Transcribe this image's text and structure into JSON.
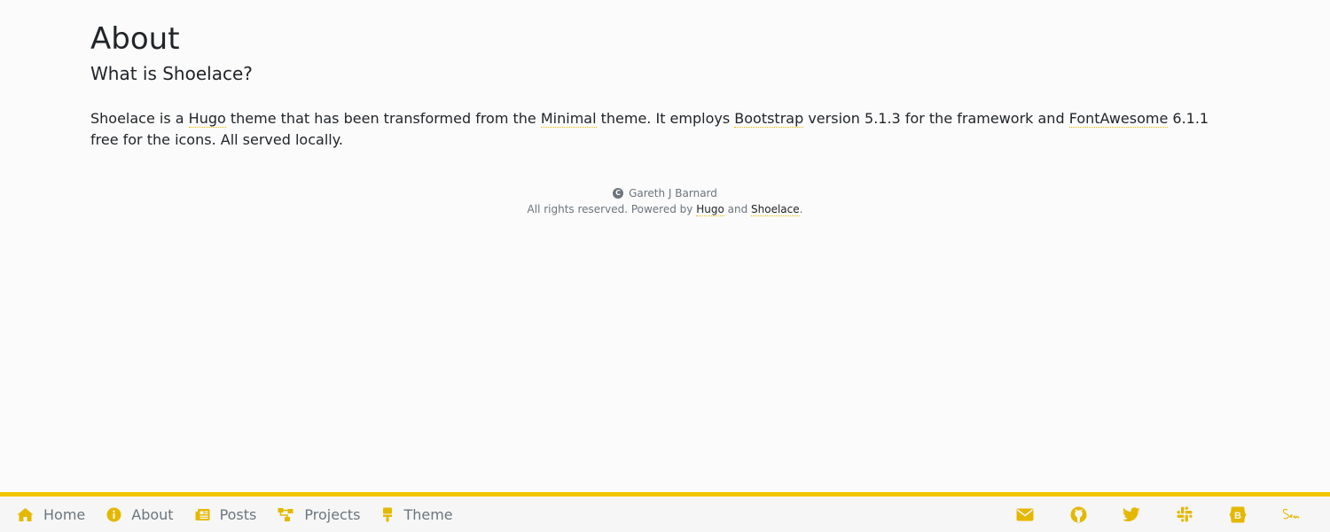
{
  "main": {
    "title": "About",
    "subtitle": "What is Shoelace?",
    "paragraph": {
      "t1": "Shoelace is a ",
      "link1": "Hugo",
      "t2": " theme that has been transformed from the ",
      "link2": "Minimal",
      "t3": " theme. It employs ",
      "link3": "Bootstrap",
      "t4": " version 5.1.3 for the framework and ",
      "link4": "FontAwesome",
      "t5": " 6.1.1 free for the icons. All served locally."
    }
  },
  "footer": {
    "author": "Gareth J Barnard",
    "rights_text": "All rights reserved. Powered by ",
    "hugo_link": "Hugo",
    "and_text": " and ",
    "shoelace_link": "Shoelace",
    "period": "."
  },
  "nav": {
    "items": [
      {
        "label": "Home",
        "icon": "home-icon"
      },
      {
        "label": "About",
        "icon": "info-icon"
      },
      {
        "label": "Posts",
        "icon": "newspaper-icon"
      },
      {
        "label": "Projects",
        "icon": "sitemap-icon"
      },
      {
        "label": "Theme",
        "icon": "paintbrush-icon"
      }
    ],
    "social": [
      "envelope-icon",
      "github-icon",
      "twitter-icon",
      "slack-icon",
      "bootstrap-icon",
      "sass-icon"
    ]
  },
  "colors": {
    "accent": "#f3c500",
    "icon": "#e5b800",
    "text": "#212529",
    "muted": "#6c757d",
    "background": "#fbfbfb"
  }
}
